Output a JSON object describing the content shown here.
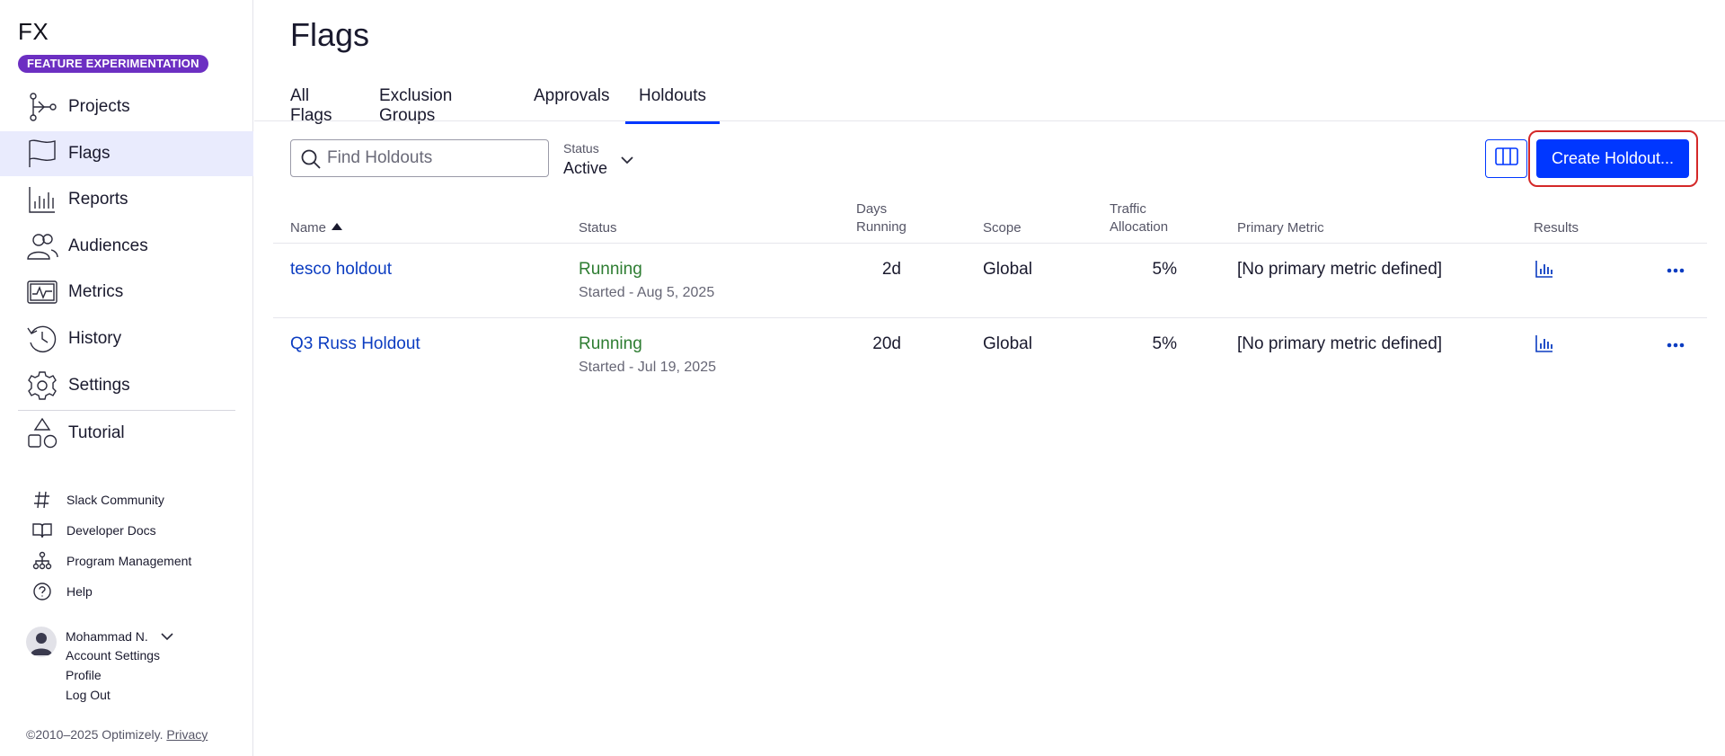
{
  "sidebar": {
    "logo": "FX",
    "badge": "FEATURE EXPERIMENTATION",
    "nav": [
      {
        "label": "Projects",
        "icon": "projects-icon"
      },
      {
        "label": "Flags",
        "icon": "flag-icon",
        "active": true
      },
      {
        "label": "Reports",
        "icon": "reports-icon"
      },
      {
        "label": "Audiences",
        "icon": "audiences-icon"
      },
      {
        "label": "Metrics",
        "icon": "metrics-icon"
      },
      {
        "label": "History",
        "icon": "history-icon"
      },
      {
        "label": "Settings",
        "icon": "gear-icon"
      },
      {
        "label": "Tutorial",
        "icon": "shapes-icon"
      }
    ],
    "resources": [
      {
        "label": "Slack Community",
        "icon": "hash-icon"
      },
      {
        "label": "Developer Docs",
        "icon": "book-icon"
      },
      {
        "label": "Program Management",
        "icon": "org-chart-icon"
      },
      {
        "label": "Help",
        "icon": "help-icon"
      }
    ],
    "user": {
      "name": "Mohammad N.",
      "links": [
        "Account Settings",
        "Profile",
        "Log Out"
      ]
    },
    "copyright": "©2010–2025 Optimizely.",
    "privacy": "Privacy"
  },
  "main": {
    "title": "Flags",
    "tabs": [
      {
        "label": "All Flags"
      },
      {
        "label": "Exclusion Groups"
      },
      {
        "label": "Approvals"
      },
      {
        "label": "Holdouts",
        "active": true
      }
    ],
    "search": {
      "placeholder": "Find Holdouts",
      "value": ""
    },
    "status_filter": {
      "label": "Status",
      "value": "Active"
    },
    "create_button": "Create Holdout...",
    "accent": "#0037ff",
    "highlight": "#d42828"
  },
  "table": {
    "headers": {
      "name": "Name",
      "status": "Status",
      "days_line1": "Days",
      "days_line2": "Running",
      "scope": "Scope",
      "traffic_line1": "Traffic",
      "traffic_line2": "Allocation",
      "metric": "Primary Metric",
      "results": "Results"
    },
    "rows": [
      {
        "name": "tesco holdout",
        "status": "Running",
        "started": "Started - Aug 5, 2025",
        "days": "2d",
        "scope": "Global",
        "traffic": "5%",
        "metric": "[No primary metric defined]"
      },
      {
        "name": "Q3 Russ Holdout",
        "status": "Running",
        "started": "Started - Jul 19, 2025",
        "days": "20d",
        "scope": "Global",
        "traffic": "5%",
        "metric": "[No primary metric defined]"
      }
    ]
  }
}
